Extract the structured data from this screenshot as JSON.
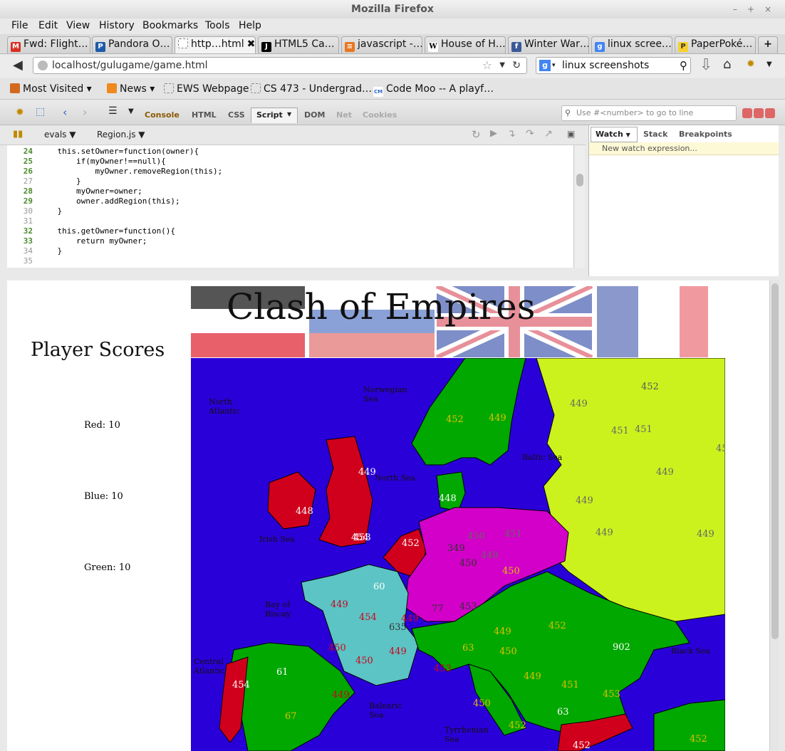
{
  "window": {
    "title": "Mozilla Firefox"
  },
  "menu": [
    "File",
    "Edit",
    "View",
    "History",
    "Bookmarks",
    "Tools",
    "Help"
  ],
  "tabs": [
    {
      "label": "Fwd: Flight…",
      "icon": "gmail-icon",
      "color": "#d93025"
    },
    {
      "label": "Pandora O…",
      "icon": "pandora-icon",
      "color": "#1e5aa8"
    },
    {
      "label": "http…html",
      "icon": "blank-page-icon",
      "color": "#ffffff",
      "active": true
    },
    {
      "label": "HTML5 Ca…",
      "icon": "j-icon",
      "color": "#000000"
    },
    {
      "label": "javascript -…",
      "icon": "stackoverflow-icon",
      "color": "#e87722"
    },
    {
      "label": "House of H…",
      "icon": "wikipedia-icon",
      "color": "#ffffff"
    },
    {
      "label": "Winter War…",
      "icon": "facebook-icon",
      "color": "#3b5998"
    },
    {
      "label": "linux scree…",
      "icon": "google-icon",
      "color": "#4285f4"
    },
    {
      "label": "PaperPoké…",
      "icon": "pokemon-icon",
      "color": "#f6d12e"
    }
  ],
  "nav": {
    "url": "localhost/gulugame/game.html",
    "search": "linux screenshots"
  },
  "bookmarks": [
    "Most Visited",
    "News",
    "EWS Webpage",
    "CS 473 - Undergrad…",
    "Code Moo -- A playf…"
  ],
  "firebug": {
    "tabs": [
      "Console",
      "HTML",
      "CSS",
      "Script",
      "DOM",
      "Net",
      "Cookies"
    ],
    "search_placeholder": "Use #<number> to go to line",
    "sources": [
      "evals",
      "Region.js"
    ],
    "side_tabs": [
      "Watch",
      "Stack",
      "Breakpoints"
    ],
    "watch_hint": "New watch expression...",
    "code_lines": [
      {
        "n": "24",
        "t": "    this.setOwner=function(owner){",
        "active": true
      },
      {
        "n": "25",
        "t": "        if(myOwner!==null){",
        "active": true
      },
      {
        "n": "26",
        "t": "            myOwner.removeRegion(this);",
        "active": true
      },
      {
        "n": "27",
        "t": "        }",
        "active": false
      },
      {
        "n": "28",
        "t": "        myOwner=owner;",
        "active": true
      },
      {
        "n": "29",
        "t": "        owner.addRegion(this);",
        "active": true
      },
      {
        "n": "30",
        "t": "    }",
        "active": false
      },
      {
        "n": "31",
        "t": "",
        "active": false
      },
      {
        "n": "32",
        "t": "    this.getOwner=function(){",
        "active": true
      },
      {
        "n": "33",
        "t": "        return myOwner;",
        "active": true
      },
      {
        "n": "34",
        "t": "    }",
        "active": false
      },
      {
        "n": "35",
        "t": "",
        "active": false
      }
    ]
  },
  "game": {
    "title": "Clash of Empires",
    "scores_heading": "Player Scores",
    "scores": [
      "Red: 10",
      "Blue: 10",
      "Green: 10"
    ]
  },
  "map": {
    "colors": {
      "sea": "#2a00d8",
      "red": "#d0001c",
      "green": "#00a800",
      "teal": "#5cc4c4",
      "magenta": "#d200c8",
      "yellow": "#ccf21e"
    },
    "seas": [
      "North Atlantic",
      "Norwegian Sea",
      "North Sea",
      "Baltic Sea",
      "Irish Sea",
      "Bay of Biscay",
      "Central Atlantic",
      "Balearic Sea",
      "Tyrrhenian Sea",
      "Black Sea"
    ],
    "numbers": [
      "452",
      "449",
      "451",
      "451",
      "45",
      "449",
      "449",
      "449",
      "449",
      "452",
      "449",
      "453",
      "448",
      "449",
      "452",
      "448",
      "454",
      "349",
      "450",
      "448",
      "451",
      "60",
      "450",
      "449",
      "454",
      "635",
      "449",
      "450",
      "77",
      "453",
      "450",
      "449",
      "452",
      "902",
      "63",
      "450",
      "61",
      "454",
      "450",
      "449",
      "453",
      "449",
      "451",
      "453",
      "67",
      "449",
      "450",
      "63",
      "452",
      "452",
      "452"
    ]
  }
}
